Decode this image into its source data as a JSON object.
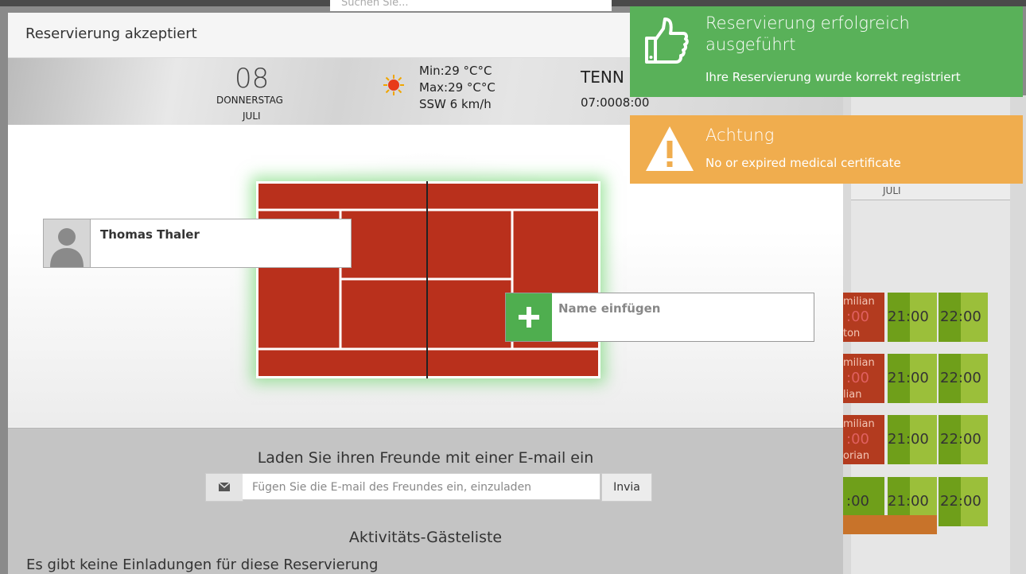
{
  "background": {
    "search_placeholder": "Suchen Sie...",
    "juli": "JULI",
    "rows": [
      {
        "name_top": "milian",
        "name_bottom": "ton",
        "t1": "21:00",
        "t2": "22:00",
        "t0": ":00"
      },
      {
        "name_top": "milian",
        "name_bottom": "lian",
        "t1": "21:00",
        "t2": "22:00",
        "t0": ":00"
      },
      {
        "name_top": "milian",
        "name_bottom": "orian",
        "t1": "21:00",
        "t2": "22:00",
        "t0": ":00"
      },
      {
        "name_top": "",
        "name_bottom": "",
        "t1": "21:00",
        "t2": "22:00",
        "t0": ":00"
      }
    ]
  },
  "modal": {
    "title": "Reservierung akzeptiert",
    "date": {
      "day": "08",
      "weekday": "DONNERSTAG",
      "month": "JULI"
    },
    "weather": {
      "icon": "sun-icon",
      "min": "Min:29 °C°C",
      "max": "Max:29 °C°C",
      "wind": "SSW 6 km/h"
    },
    "sport": "TENN",
    "time": "07:0008:00",
    "player": {
      "name": "Thomas Thaler"
    },
    "add_player": {
      "placeholder": "Name einfügen"
    },
    "invite": {
      "title": "Laden Sie ihren Freunde mit einer E-mail ein",
      "placeholder": "Fügen Sie die E-mail des Freundes ein, einzuladen",
      "send_label": "Invia"
    },
    "guests": {
      "title": "Aktivitäts-Gästeliste",
      "empty_text": "Es gibt keine Einladungen für diese Reservierung"
    }
  },
  "toasts": {
    "success": {
      "heading": "Reservierung erfolgreich ausgeführt",
      "message": "Ihre Reservierung wurde korrekt registriert",
      "color": "#59b159"
    },
    "warning": {
      "heading": "Achtung",
      "message": "No or expired medical certificate",
      "color": "#f0ad4e"
    }
  },
  "colors": {
    "court": "#b9301c",
    "add_button": "#4fae4f"
  }
}
